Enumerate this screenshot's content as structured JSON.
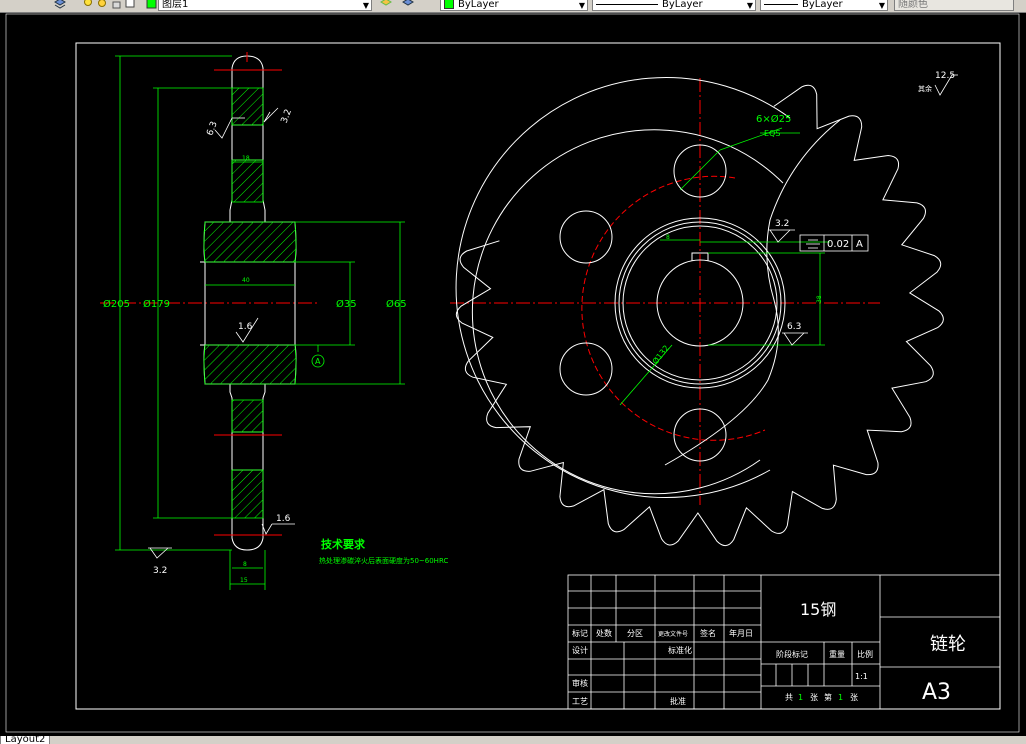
{
  "toolbar": {
    "layer_name": "图层1",
    "color": "ByLayer",
    "linetype": "ByLayer",
    "lineweight": "ByLayer",
    "plotstyle": "随颜色"
  },
  "status": {
    "layout_tab": "Layout2"
  },
  "drawing": {
    "colors": {
      "outline": "#ffffff",
      "dimension": "#00ff00",
      "center": "#ff0000",
      "hatch": "#ffffff",
      "text_green": "#00ff00"
    },
    "left_view": {
      "d_outer": "Ø205",
      "d_root": "Ø179",
      "d_bore": "Ø35",
      "d_hub": "Ø65",
      "hub_len": "40",
      "tooth_w": "18",
      "rough_63": "6.3",
      "rough_32a": "3.2",
      "rough_16a": "1.6",
      "rough_16b": "1.6",
      "rough_32b": "3.2",
      "datum": "A",
      "w15": "15",
      "w8": "8"
    },
    "right_view": {
      "holes": "6×Ø25",
      "eqs": "EQS",
      "pcd": "Ø132",
      "keyway": "38",
      "key8": "8",
      "tol_val": "0.02",
      "tol_ref": "A",
      "rough_32": "3.2",
      "rough_63": "6.3",
      "other_rough": "12.5",
      "other_label": "其余"
    },
    "tech": {
      "title": "技术要求",
      "line1": "热处理渗碳淬火后表面硬度为50~60HRC"
    },
    "title_block": {
      "material": "15钢",
      "name": "链轮",
      "sheet": "A3",
      "scale": "1:1",
      "h_mark": "标记",
      "h_count": "处数",
      "h_zone": "分区",
      "h_doc": "更改文件号",
      "h_sign": "签名",
      "h_date": "年月日",
      "h_design": "设计",
      "h_std": "标准化",
      "h_check": "审核",
      "h_process": "工艺",
      "h_approve": "批准",
      "h_stage": "阶段标记",
      "h_weight": "重量",
      "h_ratio": "比例",
      "t_total": "共",
      "t_total_n": "1",
      "t_sheet": "张",
      "t_no": "第",
      "t_no_n": "1",
      "t_sheet2": "张"
    }
  }
}
